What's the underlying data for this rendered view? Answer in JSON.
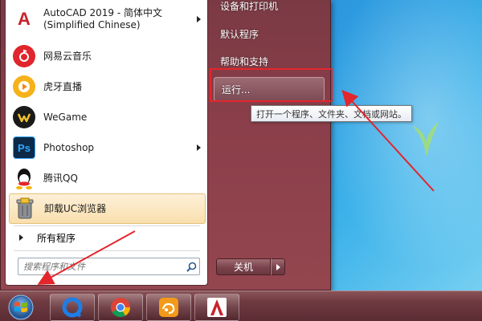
{
  "start_menu": {
    "programs": [
      {
        "label": "AutoCAD 2019 - 简体中文\n(Simplified Chinese)",
        "icon": "autocad-icon",
        "has_submenu": true
      },
      {
        "label": "网易云音乐",
        "icon": "netease-music-icon",
        "has_submenu": false
      },
      {
        "label": "虎牙直播",
        "icon": "huya-icon",
        "has_submenu": false
      },
      {
        "label": "WeGame",
        "icon": "wegame-icon",
        "has_submenu": false
      },
      {
        "label": "Photoshop",
        "icon": "photoshop-icon",
        "has_submenu": true
      },
      {
        "label": "腾讯QQ",
        "icon": "qq-icon",
        "has_submenu": false
      },
      {
        "label": "卸载UC浏览器",
        "icon": "uninstall-icon",
        "has_submenu": false,
        "highlighted": true
      }
    ],
    "all_programs_label": "所有程序",
    "search": {
      "placeholder": "搜索程序和文件"
    },
    "right_items": {
      "devices_printers": "设备和打印机",
      "default_programs": "默认程序",
      "help_support": "帮助和支持",
      "run": "运行..."
    },
    "shutdown_label": "关机",
    "run_tooltip": "打开一个程序、文件夹、文档或网站。"
  },
  "taskbar": {
    "start_icon": "windows-start-orb-icon",
    "pinned": [
      "qq-browser-icon",
      "chrome-icon",
      "uc-browser-icon",
      "autocad-icon"
    ]
  },
  "colors": {
    "menu_frame": "#8b3f4a",
    "highlight_bg": "#f9dfad",
    "annotation_red": "#e3262c",
    "taskbar": "#6e3a40"
  }
}
